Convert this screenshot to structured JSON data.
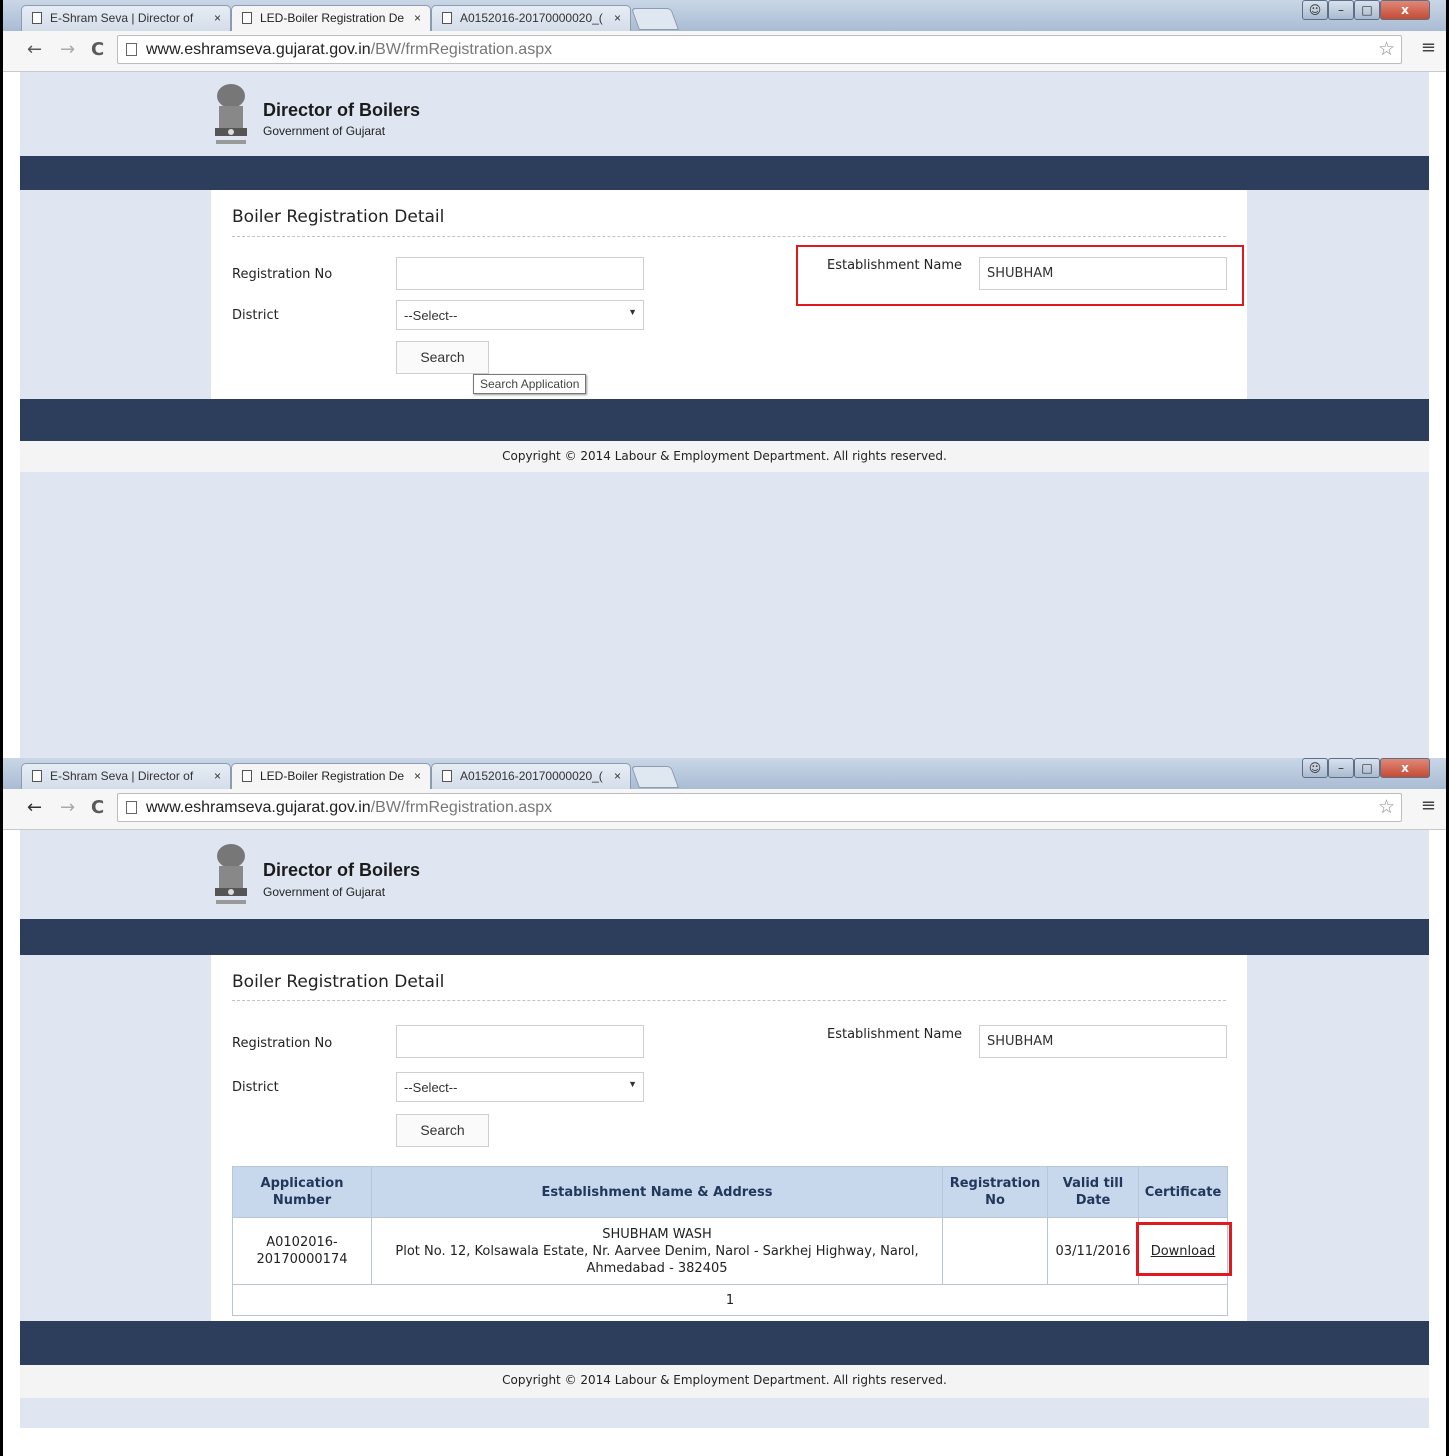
{
  "browser": {
    "tabs": [
      {
        "title": "E-Shram Seva | Director of"
      },
      {
        "title": "LED-Boiler Registration De"
      },
      {
        "title": "A0152016-20170000020_("
      }
    ],
    "url_domain": "www.eshramseva.gujarat.gov.in",
    "url_path": "/BW/frmRegistration.aspx",
    "close_glyph": "×",
    "back_glyph": "←",
    "forward_glyph": "→",
    "reload_glyph": "C",
    "star_glyph": "☆",
    "menu_glyph": "≡",
    "minimize_glyph": "–",
    "maximize_glyph": "□",
    "window_close_glyph": "x"
  },
  "header": {
    "title": "Director of Boilers",
    "subtitle": "Government of Gujarat"
  },
  "form": {
    "page_title": "Boiler Registration Detail",
    "registration_no_label": "Registration No",
    "registration_no_value": "",
    "district_label": "District",
    "district_value": "--Select--",
    "establishment_label": "Establishment Name",
    "establishment_value": "SHUBHAM",
    "search_label": "Search",
    "search_tooltip": "Search Application"
  },
  "results": {
    "columns": [
      "Application Number",
      "Establishment Name & Address",
      "Registration No",
      "Valid till Date",
      "Certificate"
    ],
    "rows": [
      {
        "application_number": "A0102016-20170000174",
        "establishment_name": "SHUBHAM WASH",
        "address": "Plot No. 12, Kolsawala Estate, Nr. Aarvee Denim, Narol - Sarkhej Highway, Narol, Ahmedabad - 382405",
        "registration_no": "",
        "valid_till": "03/11/2016",
        "certificate_link": "Download"
      }
    ],
    "pager": "1"
  },
  "footer": {
    "copyright": "Copyright © 2014 Labour & Employment Department. All rights reserved."
  },
  "colors": {
    "page_bg": "#dfe6f1",
    "nav_band": "#2c3e5c",
    "table_header": "#c8d8ec",
    "highlight": "#e0191e"
  }
}
